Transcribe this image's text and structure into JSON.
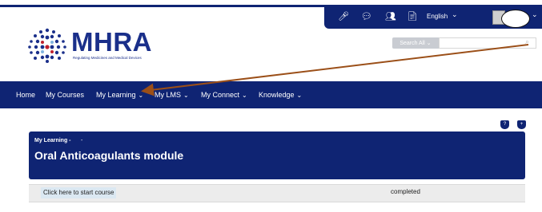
{
  "header": {
    "logo_text": "MHRA",
    "logo_subtitle": "Regulating Medicines and Medical Devices",
    "search": {
      "button_label": "Search All",
      "placeholder": ""
    }
  },
  "utility": {
    "language": "English",
    "icons": [
      "microphone-icon",
      "chat-icon",
      "people-icon",
      "document-icon"
    ]
  },
  "nav": {
    "items": [
      {
        "label": "Home",
        "has_menu": false
      },
      {
        "label": "My Courses",
        "has_menu": false
      },
      {
        "label": "My Learning",
        "has_menu": true
      },
      {
        "label": "My LMS",
        "has_menu": true
      },
      {
        "label": "My Connect",
        "has_menu": true
      },
      {
        "label": "Knowledge",
        "has_menu": true
      }
    ]
  },
  "course": {
    "breadcrumb": "My Learning -",
    "breadcrumb_sep": "-",
    "title": "Oral Anticoagulants module",
    "start_label": "Click here to start course",
    "status": "completed"
  },
  "colors": {
    "brand": "#0f2473",
    "annotation_arrow": "#9b4f18"
  }
}
